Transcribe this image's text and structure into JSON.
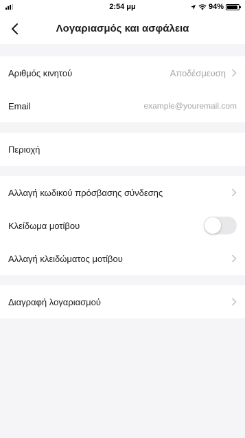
{
  "status_bar": {
    "time": "2:54 μμ",
    "battery_text": "94%",
    "battery_level": 0.94
  },
  "header": {
    "title": "Λογαριασμός και ασφάλεια"
  },
  "account_group": {
    "phone_label": "Αριθμός κινητού",
    "phone_value": "Αποδέσμευση",
    "email_label": "Email",
    "email_value": "example@youremail.com"
  },
  "region_group": {
    "region_label": "Περιοχή"
  },
  "security_group": {
    "change_password_label": "Αλλαγή κωδικού πρόσβασης σύνδεσης",
    "pattern_lock_label": "Κλείδωμα μοτίβου",
    "pattern_lock_enabled": false,
    "change_pattern_label": "Αλλαγή κλειδώματος μοτίβου"
  },
  "delete_group": {
    "delete_account_label": "Διαγραφή λογαριασμού"
  },
  "icons": {
    "back": "chevron-left-icon",
    "row_arrow": "chevron-right-icon"
  }
}
